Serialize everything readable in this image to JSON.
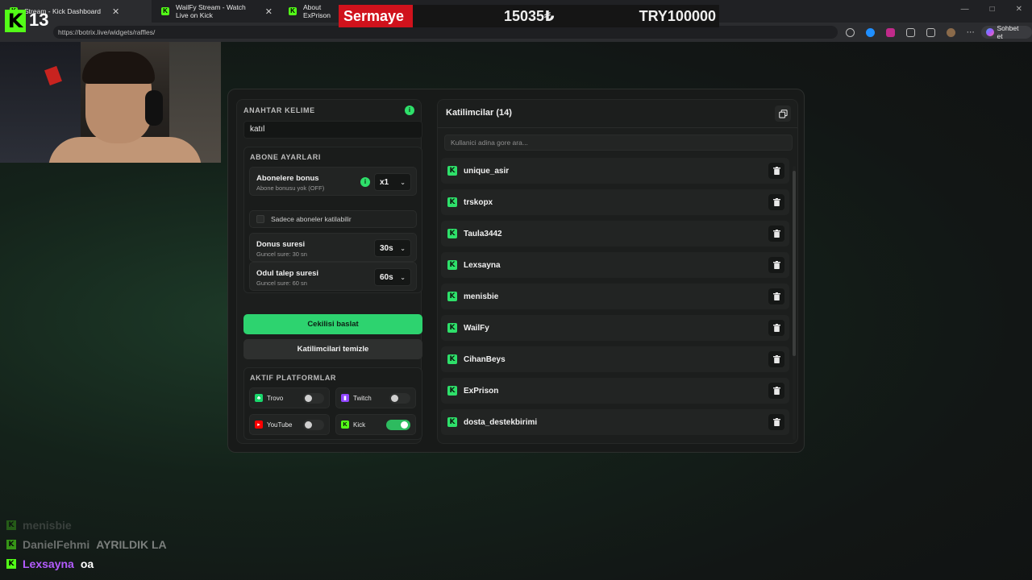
{
  "browser": {
    "tabs": [
      {
        "title": "Stream - Kick Dashboard",
        "close": "✕",
        "active": true
      },
      {
        "title": "WailFy Stream - Watch Live on Kick",
        "close": "✕",
        "active": false
      },
      {
        "title": "About ExPrison",
        "close": "",
        "active": false
      }
    ],
    "url": "https://botrix.live/widgets/raffles/",
    "chat_button": "Sohbet et",
    "window_controls": [
      "—",
      "□",
      "✕"
    ]
  },
  "overlay": {
    "kick_badge": "K",
    "kick_number": "13",
    "ticker": {
      "label": "Sermaye",
      "value1": "15035₺",
      "value2": "TRY100000"
    }
  },
  "raffle": {
    "keyword": {
      "title": "ANAHTAR KELIME",
      "value": "katıl",
      "info": "i"
    },
    "subscriber": {
      "title": "ABONE AYARLARI",
      "bonus": {
        "label": "Abonelere bonus",
        "sub": "Abone bonusu yok (OFF)",
        "value": "x1",
        "info": "i"
      },
      "only_subs": "Sadece aboneler katilabilir",
      "duration": {
        "label": "Donus suresi",
        "sub": "Guncel sure: 30 sn",
        "value": "30s"
      },
      "claim": {
        "label": "Odul talep suresi",
        "sub": "Guncel sure: 60 sn",
        "value": "60s"
      }
    },
    "start_button": "Cekilisi baslat",
    "clear_button": "Katilimcilari temizle",
    "platforms": {
      "title": "AKTIF PLATFORMLAR",
      "items": [
        {
          "name": "Trovo",
          "enabled": false,
          "icon": "trovo-icon",
          "color": "#19d66b"
        },
        {
          "name": "Twitch",
          "enabled": false,
          "icon": "twitch-icon",
          "color": "#9146ff"
        },
        {
          "name": "YouTube",
          "enabled": false,
          "icon": "youtube-icon",
          "color": "#ff0000"
        },
        {
          "name": "Kick",
          "enabled": true,
          "icon": "kick-icon",
          "color": "#53fc18"
        }
      ]
    },
    "participants": {
      "title": "Katilimcilar (14)",
      "search_placeholder": "Kullanici adina gore ara...",
      "list": [
        "unique_asir",
        "trskopx",
        "Taula3442",
        "Lexsayna",
        "menisbie",
        "WailFy",
        "CihanBeys",
        "ExPrison",
        "dosta_destekbirimi"
      ]
    }
  },
  "chat": [
    {
      "user": "menisbie",
      "text": "",
      "color": "#9b9b9b"
    },
    {
      "user": "DanielFehmi",
      "text": "AYRILDIK LA",
      "color": "#b0b0b0"
    },
    {
      "user": "Lexsayna",
      "text": "oa",
      "color": "#b45cff"
    }
  ],
  "colors": {
    "accent": "#2dd36f",
    "kick": "#53fc18",
    "ticker_red": "#d0121c"
  }
}
